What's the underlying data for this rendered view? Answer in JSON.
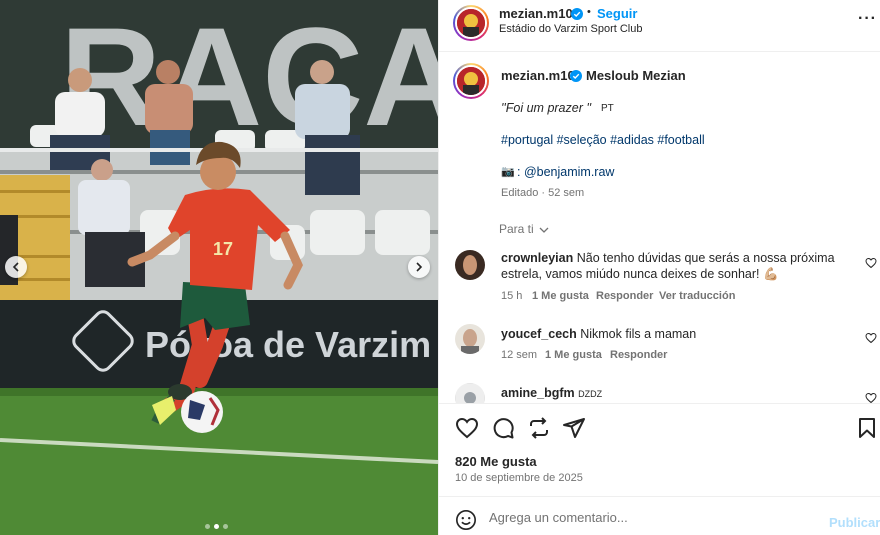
{
  "header": {
    "username": "mezian.m10",
    "follow_label": "Seguir",
    "separator": "•",
    "location": "Estádio do Varzim Sport Club",
    "more_label": "···"
  },
  "media": {
    "banner_text": "Póvoa de Varzim",
    "wall_text": "RACA",
    "jersey_number": "17",
    "active_slide": 2,
    "slide_count": 3
  },
  "caption": {
    "username": "mezian.m10",
    "mention_name": "Mesloub Mezian",
    "quote": "''Foi um prazer ''",
    "lang": "PT",
    "hashtags": "#portugal #seleção #adidas #football",
    "camera_emoji": "📷",
    "credit": ": @benjamim.raw",
    "edited": "Editado · 52 sem"
  },
  "filter": {
    "label": "Para ti"
  },
  "comments": [
    {
      "username": "crownleyian",
      "text": "Não tenho dúvidas que serás a nossa próxima estrela, vamos miúdo nunca deixes de sonhar! 💪🏼",
      "time": "15 h",
      "likes": "1 Me gusta",
      "reply": "Responder",
      "translate": "Ver traducción"
    },
    {
      "username": "youcef_cech",
      "text": "Nikmok fils a maman",
      "time": "12 sem",
      "likes": "1 Me gusta",
      "reply": "Responder"
    },
    {
      "username": "amine_bgfm",
      "text": "DZDZ"
    }
  ],
  "actions": {
    "likes": "820 Me gusta",
    "date": "10 de septiembre de 2025"
  },
  "composer": {
    "placeholder": "Agrega un comentario...",
    "publish": "Publicar"
  },
  "colors": {
    "accent": "#0095f6",
    "publish_disabled": "#b2dffc",
    "hashtag": "#00376b",
    "muted": "#737373"
  }
}
